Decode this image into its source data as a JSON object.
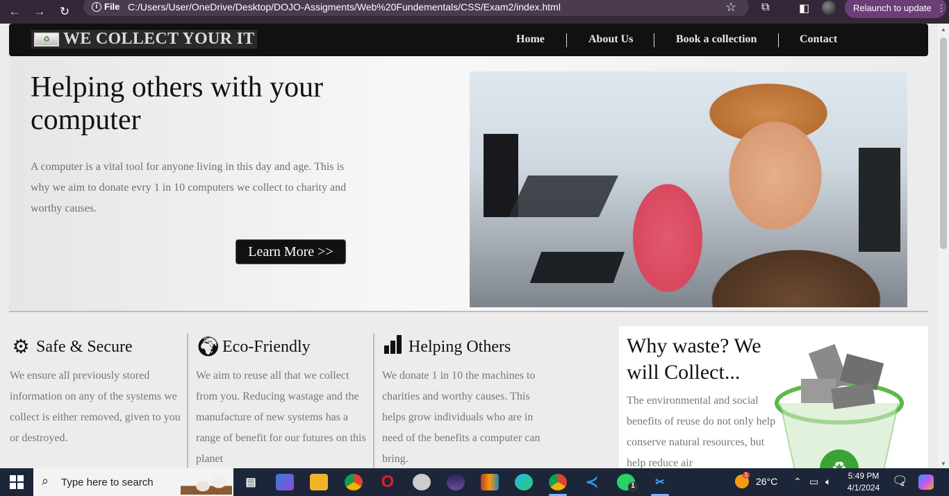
{
  "browser": {
    "file_label": "File",
    "url": "C:/Users/User/OneDrive/Desktop/DOJO-Assigments/Web%20Fundementals/CSS/Exam2/index.html",
    "relaunch_label": "Relaunch to update",
    "back_icon": "←",
    "forward_icon": "→",
    "reload_icon": "↻",
    "star_icon": "☆",
    "menu_icon": "⋮"
  },
  "site": {
    "logo_text": "WE COLLECT YOUR IT",
    "nav": {
      "home": "Home",
      "about": "About Us",
      "book": "Book a collection",
      "contact": "Contact"
    },
    "hero": {
      "title": "Helping others with your computer",
      "text": "A computer is a vital tool for anyone living in this day and age. This is why we aim to donate evry 1 in 10 computers we collect to charity and worthy causes.",
      "button": "Learn More >>"
    },
    "features": [
      {
        "title": "Safe & Secure",
        "icon": "gear-icon",
        "text": "We ensure all previously stored information on any of the systems we collect is either removed, given to you or destroyed."
      },
      {
        "title": "Eco-Friendly",
        "icon": "globe-icon",
        "text": "We aim to reuse all that we collect from you. Reducing wastage and the manufacture of new systems has a range of benefit for our futures on this planet"
      },
      {
        "title": "Helping Others",
        "icon": "bar-chart-icon",
        "text": "We donate 1 in 10 the machines to charities and worthy causes. This helps grow individuals who are in need of the benefits a computer can bring."
      }
    ],
    "why": {
      "title": "Why waste? We will Collect...",
      "text": "The environmental and social benefits of reuse do not only help conserve natural resources, but help reduce air"
    }
  },
  "taskbar": {
    "search_placeholder": "Type here to search",
    "weather": "26°C",
    "time": "5:49 PM",
    "date": "4/1/2024",
    "notification_count": "4",
    "whatsapp_badge": "1",
    "weather_badge": "1"
  }
}
